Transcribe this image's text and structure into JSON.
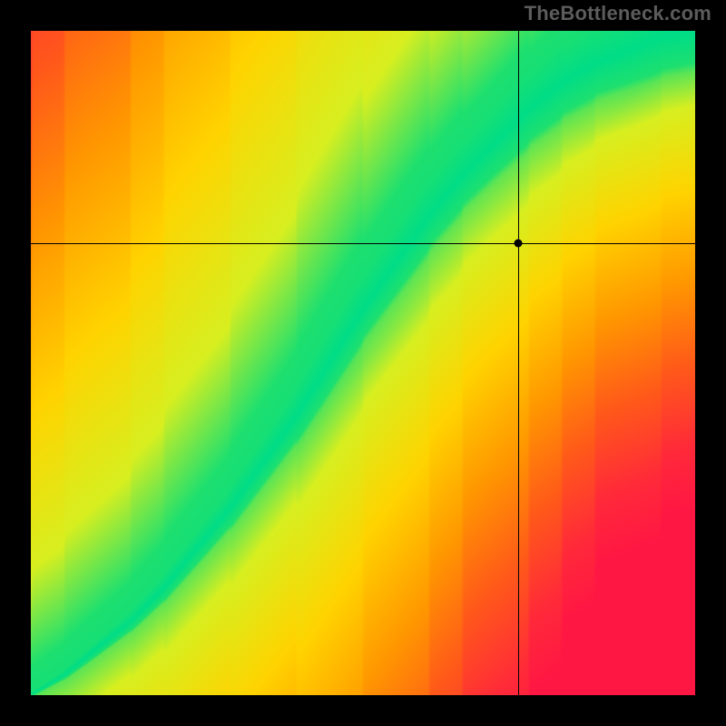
{
  "watermark": "TheBottleneck.com",
  "chart_data": {
    "type": "heatmap",
    "title": "",
    "xlabel": "",
    "ylabel": "",
    "xlim": [
      0,
      1
    ],
    "ylim": [
      0,
      1
    ],
    "crosshair": {
      "x": 0.735,
      "y": 0.68
    },
    "optimal_curve": {
      "description": "Centerline of the green (optimal) band, y as a function of x, normalized to [0,1].",
      "x": [
        0.0,
        0.05,
        0.1,
        0.15,
        0.2,
        0.25,
        0.3,
        0.35,
        0.4,
        0.45,
        0.5,
        0.55,
        0.6,
        0.65,
        0.7,
        0.75,
        0.8,
        0.85,
        0.9,
        0.95,
        1.0
      ],
      "y": [
        0.0,
        0.03,
        0.07,
        0.11,
        0.16,
        0.22,
        0.28,
        0.35,
        0.42,
        0.5,
        0.58,
        0.65,
        0.72,
        0.78,
        0.83,
        0.88,
        0.92,
        0.95,
        0.97,
        0.99,
        1.0
      ]
    },
    "band_halfwidth": {
      "description": "Approximate half-width of the green band (perpendicular, normalized units) at each x.",
      "x": [
        0.0,
        0.1,
        0.2,
        0.3,
        0.4,
        0.5,
        0.6,
        0.7,
        0.8,
        0.9,
        1.0
      ],
      "hw": [
        0.003,
        0.01,
        0.015,
        0.02,
        0.025,
        0.03,
        0.035,
        0.04,
        0.048,
        0.055,
        0.06
      ]
    },
    "color_stops": {
      "description": "Color as a function of distance-to-optimal ratio r (0 = on curve, 1 = far edge).",
      "stops": [
        {
          "r": 0.0,
          "color": "#00dd88"
        },
        {
          "r": 0.12,
          "color": "#1ee070"
        },
        {
          "r": 0.22,
          "color": "#d8ef20"
        },
        {
          "r": 0.38,
          "color": "#ffd400"
        },
        {
          "r": 0.55,
          "color": "#ff9a00"
        },
        {
          "r": 0.72,
          "color": "#ff5a1a"
        },
        {
          "r": 0.88,
          "color": "#ff2a3a"
        },
        {
          "r": 1.0,
          "color": "#ff1744"
        }
      ]
    },
    "side_bias": {
      "description": "Above the curve trends more yellow; below trends more red. Multiplier on r for each side.",
      "above": 0.78,
      "below": 1.25
    }
  }
}
